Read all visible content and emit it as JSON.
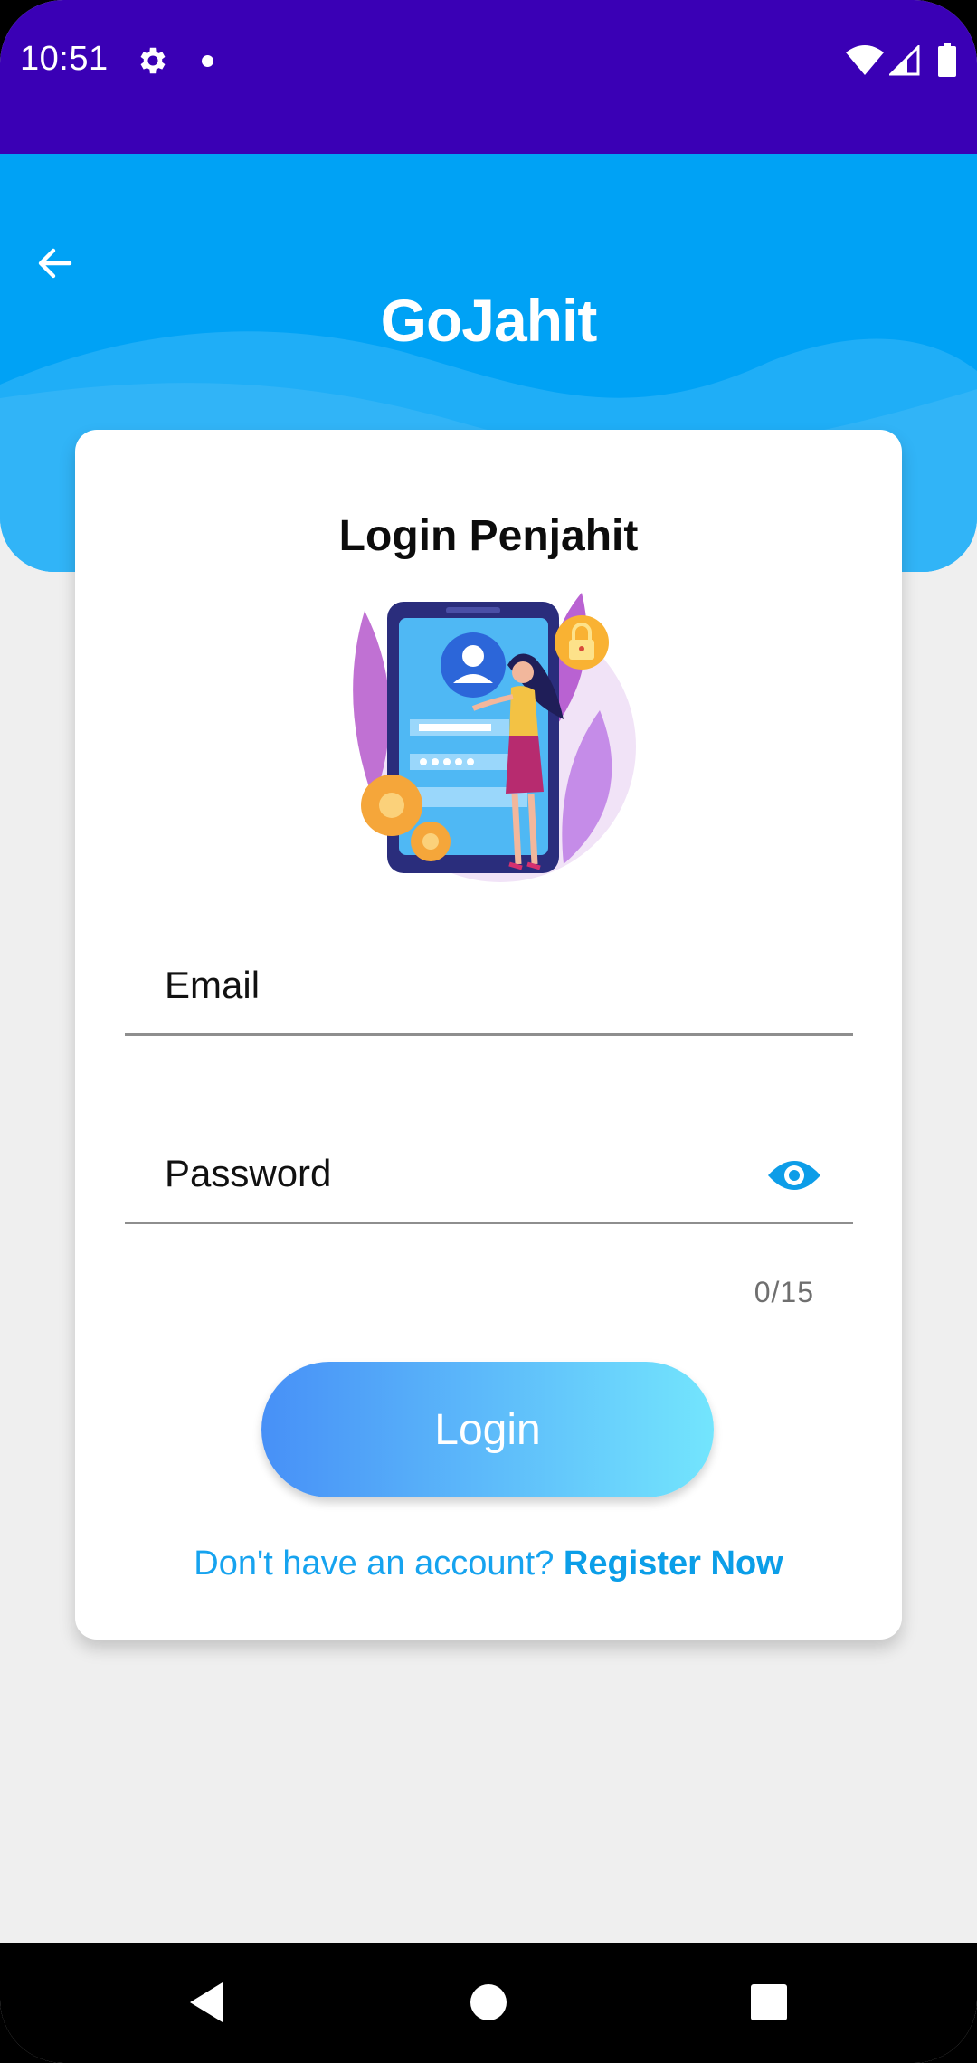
{
  "status_bar": {
    "time": "10:51",
    "icons": [
      "gear-icon",
      "dot-icon",
      "wifi-icon",
      "signal-icon",
      "battery-icon"
    ]
  },
  "header": {
    "title": "GoJahit",
    "back_icon": "arrow-left-icon",
    "color": "#00a2f5"
  },
  "card": {
    "title": "Login Penjahit",
    "illustration": "phone-login-illustration",
    "email": {
      "placeholder": "Email",
      "value": ""
    },
    "password": {
      "placeholder": "Password",
      "value": "",
      "counter": "0/15",
      "toggle_icon": "eye-icon"
    },
    "login_label": "Login",
    "register_prompt": "Don't have an account?",
    "register_link": "Register Now"
  },
  "nav_bar": {
    "icons": [
      "back-triangle-icon",
      "home-circle-icon",
      "recents-square-icon"
    ]
  },
  "colors": {
    "status_bar": "#3a00b5",
    "accent": "#16a3ef",
    "button_start": "#4790f7",
    "button_end": "#73e5fd",
    "background": "#efefef"
  }
}
